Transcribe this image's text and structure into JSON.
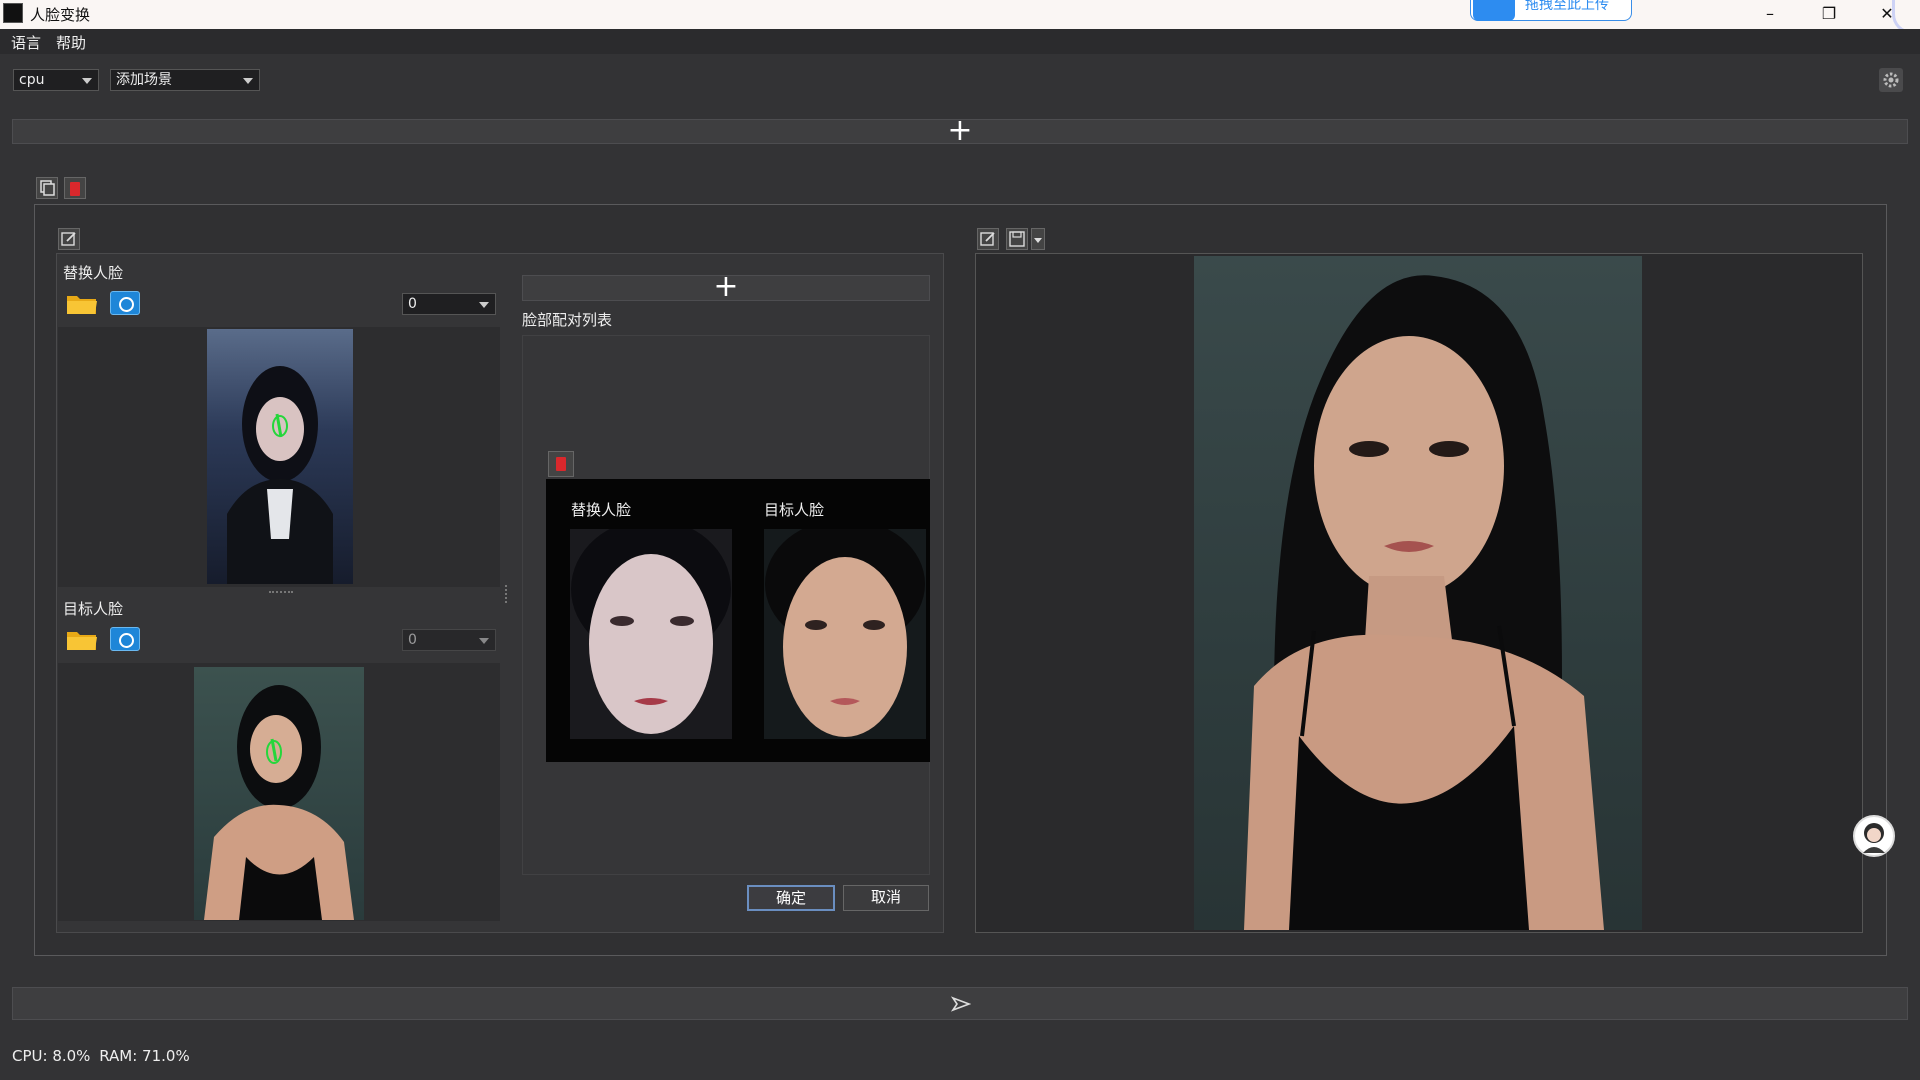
{
  "window": {
    "title": "人脸变换",
    "cloud_badge": "拖拽至此上传",
    "minimize": "–",
    "restore": "❐",
    "close": "✕"
  },
  "menu": [
    "语言",
    "帮助"
  ],
  "toolbar": {
    "device": "cpu",
    "scene": "添加场景"
  },
  "add_bar_plus": "+",
  "swap_panel": {
    "source_label": "替换人脸",
    "source_index": "0",
    "target_label": "目标人脸",
    "target_index": "0",
    "pair_list_label": "脸部配对列表",
    "pair_add_plus": "+",
    "pair": {
      "source_label": "替换人脸",
      "target_label": "目标人脸"
    },
    "ok": "确定",
    "cancel": "取消"
  },
  "status": {
    "cpu": "CPU: 8.0%",
    "ram": "RAM: 71.0%"
  },
  "colors": {
    "background": "#333335",
    "panel": "#2a2a2c",
    "delete_red": "#d9282c",
    "accent_blue": "#2d8cf0",
    "landmark_green": "#25d63b"
  }
}
